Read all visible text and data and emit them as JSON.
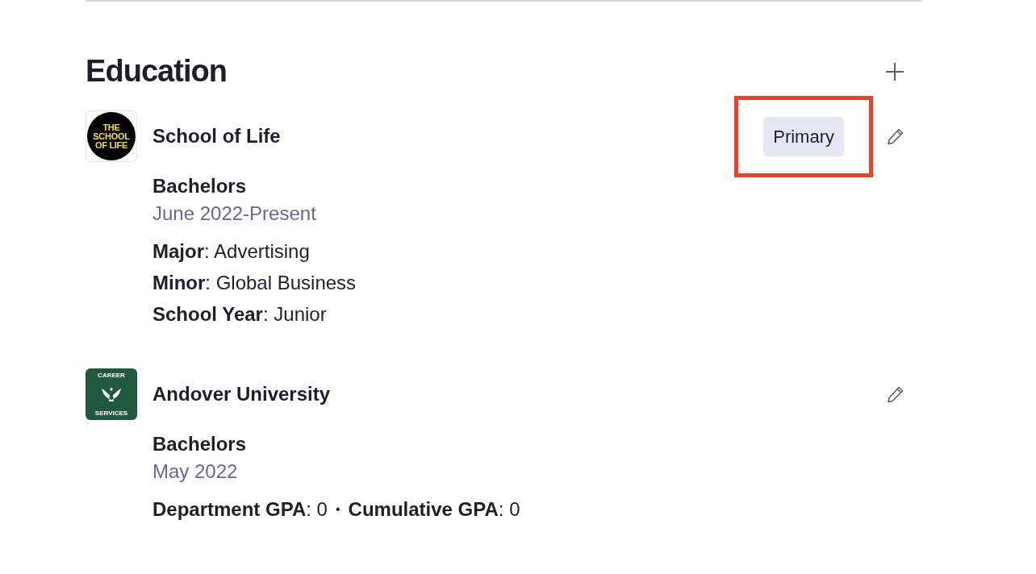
{
  "section": {
    "title": "Education"
  },
  "entries": [
    {
      "school": "School of Life",
      "logo": {
        "kind": "school-of-life",
        "lines": [
          "THE",
          "SCHOOL",
          "OF LIFE"
        ]
      },
      "badge": {
        "label": "Primary",
        "highlighted": true
      },
      "degree": "Bachelors",
      "dates": "June 2022-Present",
      "kind": "stacked",
      "fields": [
        {
          "label": "Major",
          "value": ": Advertising"
        },
        {
          "label": "Minor",
          "value": ": Global Business"
        },
        {
          "label": "School Year",
          "value": ": Junior"
        }
      ]
    },
    {
      "school": "Andover University",
      "logo": {
        "kind": "career-services",
        "lines": [
          "CAREER",
          "SERVICES"
        ]
      },
      "degree": "Bachelors",
      "dates": "May 2022",
      "kind": "inline",
      "separator": "•",
      "fields": [
        {
          "label": "Department GPA",
          "value": ": 0"
        },
        {
          "label": "Cumulative GPA",
          "value": ": 0"
        }
      ]
    }
  ]
}
